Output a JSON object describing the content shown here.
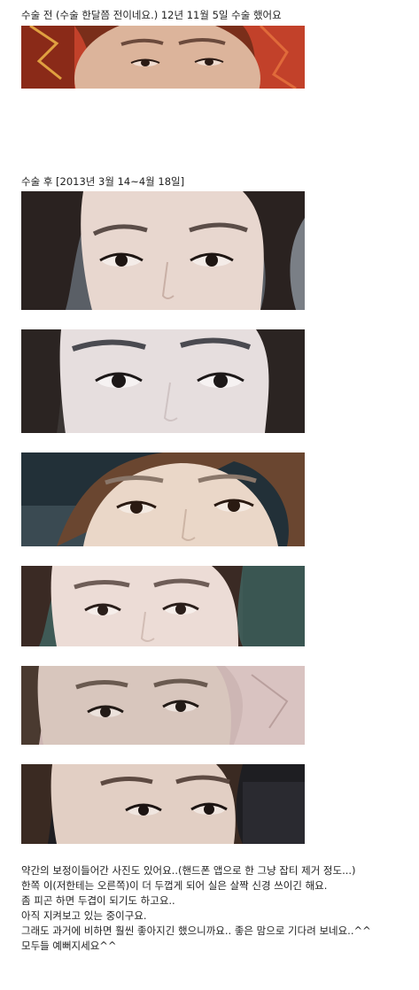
{
  "before": {
    "caption": "수술 전 (수술 한달쯤 전이네요.) 12년 11월 5일 수술 했어요"
  },
  "after": {
    "caption": "수술 후 [2013년 3월 14~4월 18일]"
  },
  "photos": [
    {
      "name": "before",
      "bg": "#c2412a",
      "skin": "#dcb49b",
      "hair": "#7a2e1a",
      "brow": "#6b4a3c"
    },
    {
      "name": "after-1",
      "bg": "#5a5f66",
      "skin": "#e8d7cf",
      "hair": "#2a2220",
      "brow": "#5b4d48"
    },
    {
      "name": "after-2",
      "bg": "#3b3634",
      "skin": "#e6dede",
      "hair": "#2b2422",
      "brow": "#4a4a50"
    },
    {
      "name": "after-3",
      "bg": "#223038",
      "skin": "#ead7c8",
      "hair": "#6a4630",
      "brow": "#8a776a"
    },
    {
      "name": "after-4",
      "bg": "#3f5a56",
      "skin": "#ecdcd6",
      "hair": "#3a2a24",
      "brow": "#6e5d57"
    },
    {
      "name": "after-5",
      "bg": "#cdb6b4",
      "skin": "#d8c6bd",
      "hair": "#4a3a30",
      "brow": "#6a5a50"
    },
    {
      "name": "after-6",
      "bg": "#1e1e22",
      "skin": "#e2cfc4",
      "hair": "#3a2a22",
      "brow": "#5d4a42"
    }
  ],
  "body": {
    "lines": [
      "약간의 보정이들어간 사진도 있어요..(핸드폰 앱으로 한 그냥 잡티 제거 정도...)",
      "한쪽 이(저한테는 오른쪽)이 더 두껍게 되어 실은 살짝 신경 쓰이긴 해요.",
      "좀 피곤 하면 두겹이 되기도 하고요..",
      "아직 지켜보고 있는 중이구요.",
      "그래도 과거에 비하면 훨씬 좋아지긴 했으니까요.. 좋은 맘으로 기다려 보네요..^^",
      "모두들 예뻐지세요^^"
    ]
  }
}
